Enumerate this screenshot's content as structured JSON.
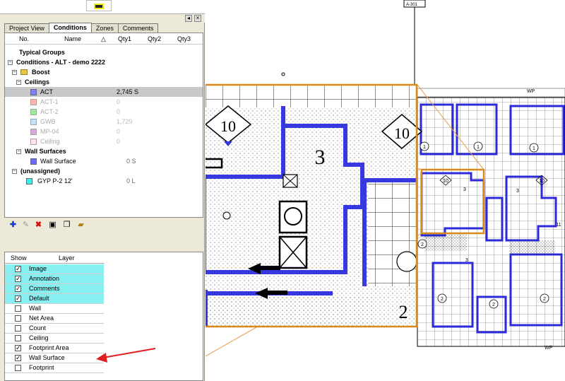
{
  "tabs": [
    "Project View",
    "Conditions",
    "Zones",
    "Comments"
  ],
  "conditions_header": {
    "no": "No.",
    "name": "Name",
    "qty1": "Qty1",
    "qty2": "Qty2",
    "qty3": "Qty3"
  },
  "tree": {
    "typical_groups": "Typical Groups",
    "conditions_root": "Conditions - ALT - demo 2222",
    "boost": "Boost",
    "ceilings": "Ceilings",
    "ceiling_items": [
      {
        "name": "ACT",
        "qty": "2,745 S",
        "color": "#8080ff"
      },
      {
        "name": "ACT-1",
        "qty": "0",
        "color": "#ff8080"
      },
      {
        "name": "ACT-2",
        "qty": "0",
        "color": "#60e060"
      },
      {
        "name": "GWB",
        "qty": "1,729",
        "color": "#9fd0ff"
      },
      {
        "name": "MP-04",
        "qty": "0",
        "color": "#c070c0"
      },
      {
        "name": "Ceiling",
        "qty": "0",
        "color": "#ffd0d0"
      }
    ],
    "wall_surfaces": "Wall Surfaces",
    "wall_surface_item": {
      "name": "Wall Surface",
      "qty": "0 S",
      "color": "#6a6aff"
    },
    "unassigned": "(unassigned)",
    "unassigned_item": {
      "name": "GYP P-2 12'",
      "qty": "0 L",
      "color": "#3ef0f0"
    }
  },
  "layers_header": {
    "show": "Show",
    "layer": "Layer"
  },
  "layers": [
    {
      "name": "Image",
      "checked": true,
      "highlight": true
    },
    {
      "name": "Annotation",
      "checked": true,
      "highlight": true
    },
    {
      "name": "Comments",
      "checked": true,
      "highlight": true
    },
    {
      "name": "Default",
      "checked": true,
      "highlight": true
    },
    {
      "name": "Wall",
      "checked": false,
      "highlight": false
    },
    {
      "name": "Net Area",
      "checked": false,
      "highlight": false
    },
    {
      "name": "Count",
      "checked": false,
      "highlight": false
    },
    {
      "name": "Ceiling",
      "checked": false,
      "highlight": false
    },
    {
      "name": "Footprint Area",
      "checked": true,
      "highlight": false
    },
    {
      "name": "Wall Surface",
      "checked": true,
      "highlight": false
    },
    {
      "name": "Footprint",
      "checked": false,
      "highlight": false
    }
  ],
  "drawing": {
    "sheet_tag": "A-301",
    "wp_top": "WP",
    "wp_bottom": "WP",
    "zoom_numbers": [
      "10",
      "10",
      "3",
      "2",
      "2"
    ],
    "plan_numbers": [
      "1",
      "1",
      "1",
      "10",
      "10",
      "3",
      "3",
      "2",
      "2",
      "2",
      "2",
      "3",
      "11"
    ]
  },
  "colors": {
    "accent_orange": "#d98a1a",
    "wall_blue": "#2a2ad8",
    "arrow_red": "#e02020",
    "highlight_cyan": "#88f0f0"
  }
}
